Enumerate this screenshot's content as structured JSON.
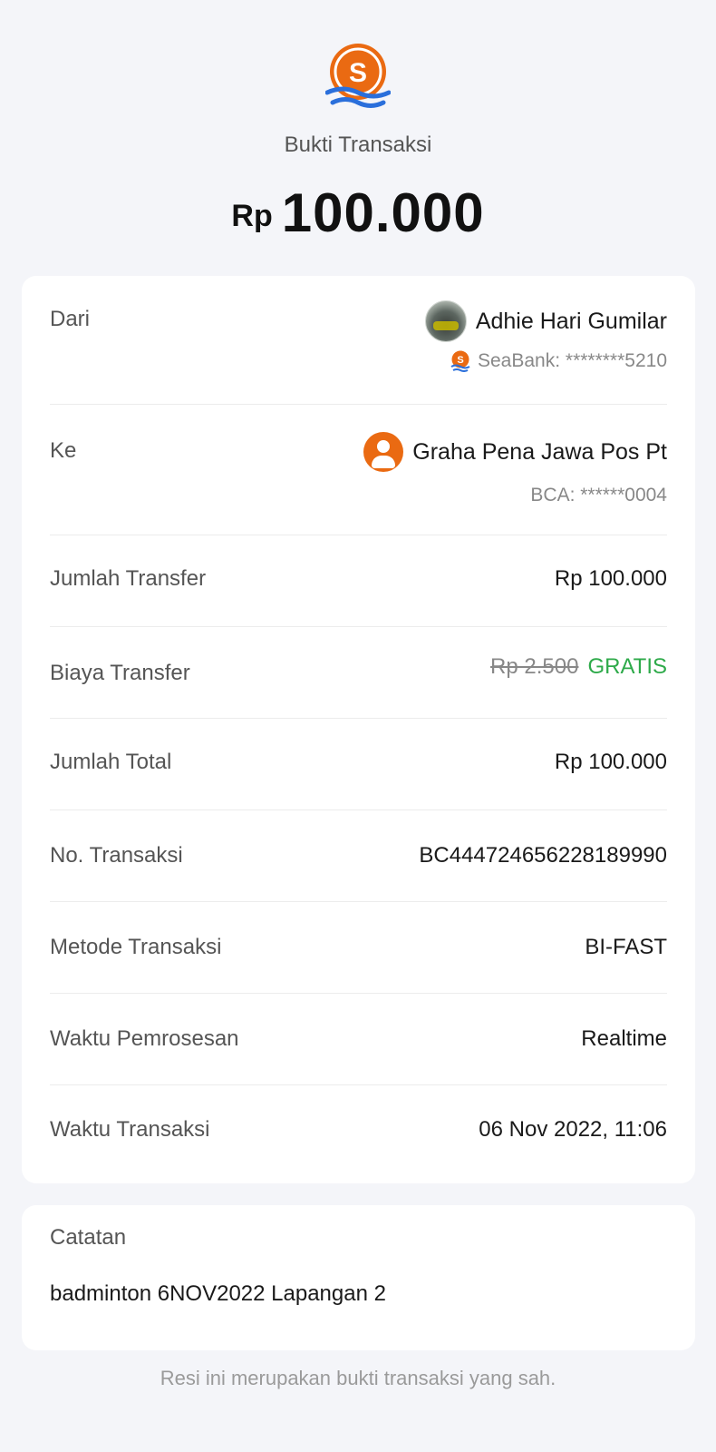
{
  "header": {
    "title": "Bukti Transaksi",
    "currency": "Rp",
    "amount": "100.000",
    "logo_icon": "seabank-logo-icon"
  },
  "details": {
    "from": {
      "label": "Dari",
      "name": "Adhie Hari Gumilar",
      "account": "SeaBank: ********5210"
    },
    "to": {
      "label": "Ke",
      "name": "Graha Pena Jawa Pos Pt",
      "account": "BCA: ******0004"
    },
    "transfer_amount": {
      "label": "Jumlah Transfer",
      "value": "Rp 100.000"
    },
    "transfer_fee": {
      "label": "Biaya Transfer",
      "original": "Rp 2.500",
      "value": "GRATIS"
    },
    "total": {
      "label": "Jumlah Total",
      "value": "Rp 100.000"
    },
    "transaction_no": {
      "label": "No. Transaksi",
      "value": "BC444724656228189990"
    },
    "method": {
      "label": "Metode Transaksi",
      "value": "BI-FAST"
    },
    "processing_time": {
      "label": "Waktu Pemrosesan",
      "value": "Realtime"
    },
    "transaction_time": {
      "label": "Waktu Transaksi",
      "value": "06 Nov 2022, 11:06"
    }
  },
  "note": {
    "label": "Catatan",
    "text": "badminton 6NOV2022 Lapangan 2"
  },
  "footer": {
    "text": "Resi ini merupakan bukti transaksi yang sah."
  },
  "colors": {
    "brand_orange": "#ea6a12",
    "wave_blue": "#2a6fdb",
    "free_green": "#2eaa4a",
    "background": "#f4f5f9"
  }
}
